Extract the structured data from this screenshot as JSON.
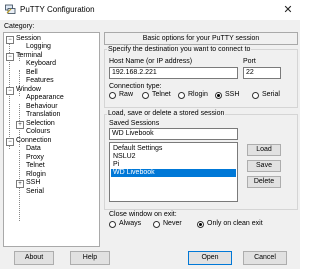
{
  "window": {
    "title": "PuTTY Configuration",
    "close_glyph": "✕",
    "icon": "putty-app-icon"
  },
  "category": {
    "label": "Category:",
    "tree": [
      {
        "label": "Session",
        "expanded": true
      },
      {
        "label": "Logging"
      },
      {
        "label": "Terminal",
        "expanded": true
      },
      {
        "label": "Keyboard"
      },
      {
        "label": "Bell"
      },
      {
        "label": "Features"
      },
      {
        "label": "Window",
        "expanded": true
      },
      {
        "label": "Appearance"
      },
      {
        "label": "Behaviour"
      },
      {
        "label": "Translation"
      },
      {
        "label": "Selection",
        "expanded": false
      },
      {
        "label": "Colours"
      },
      {
        "label": "Connection",
        "expanded": true
      },
      {
        "label": "Data"
      },
      {
        "label": "Proxy"
      },
      {
        "label": "Telnet"
      },
      {
        "label": "Rlogin"
      },
      {
        "label": "SSH",
        "expanded": false
      },
      {
        "label": "Serial"
      }
    ]
  },
  "panel": {
    "header": "Basic options for your PuTTY session",
    "destination_label": "Specify the destination you want to connect to",
    "host_label": "Host Name (or IP address)",
    "host_value": "192.168.2.221",
    "port_label": "Port",
    "port_value": "22",
    "conn_type_label": "Connection type:",
    "conn_types": [
      "Raw",
      "Telnet",
      "Rlogin",
      "SSH",
      "Serial"
    ],
    "conn_type_selected": "SSH",
    "sessions_group_label": "Load, save or delete a stored session",
    "saved_sessions_label": "Saved Sessions",
    "saved_sessions_value": "WD Livebook",
    "sessions": [
      "Default Settings",
      "NSLU2",
      "Pi",
      "WD Livebook"
    ],
    "sessions_selected": "WD Livebook",
    "load_label": "Load",
    "save_label": "Save",
    "delete_label": "Delete",
    "close_exit_label": "Close window on exit:",
    "close_exit_options": [
      "Always",
      "Never",
      "Only on clean exit"
    ],
    "close_exit_selected": "Only on clean exit"
  },
  "footer": {
    "about_label": "About",
    "help_label": "Help",
    "open_label": "Open",
    "cancel_label": "Cancel"
  },
  "colors": {
    "selection": "#0078d7",
    "dialog_bg": "#f0f0f0"
  }
}
